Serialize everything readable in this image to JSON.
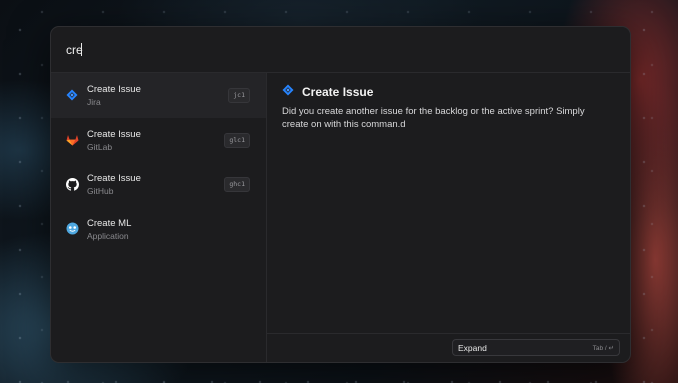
{
  "search": {
    "value": "cre"
  },
  "results": [
    {
      "title": "Create Issue",
      "subtitle": "Jira",
      "shortcut": "jc1",
      "icon": "jira-icon"
    },
    {
      "title": "Create Issue",
      "subtitle": "GitLab",
      "shortcut": "glc1",
      "icon": "gitlab-icon"
    },
    {
      "title": "Create Issue",
      "subtitle": "GitHub",
      "shortcut": "ghc1",
      "icon": "github-icon"
    },
    {
      "title": "Create ML",
      "subtitle": "Application",
      "shortcut": "",
      "icon": "create-ml-icon"
    }
  ],
  "detail": {
    "title": "Create Issue",
    "icon": "jira-icon",
    "description": "Did you create another issue for the backlog or the active sprint? Simply create on with this comman.d"
  },
  "footer": {
    "expand_label": "Expand",
    "expand_shortcut": "Tab / ↵"
  },
  "colors": {
    "jira": "#2684FF",
    "gitlab": "#E24329",
    "github": "#FFFFFF",
    "create_ml": "#4FA8E0"
  }
}
